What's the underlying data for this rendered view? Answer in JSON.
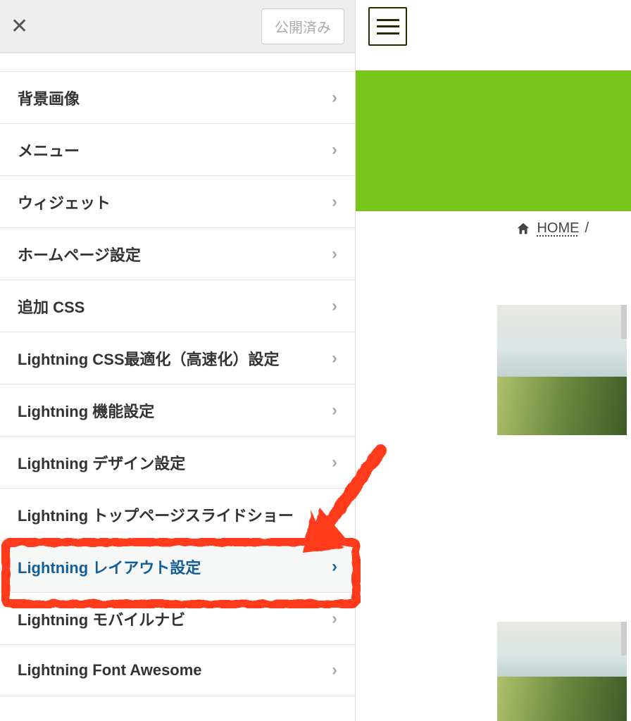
{
  "topbar": {
    "publish_label": "公開済み"
  },
  "sidebar": {
    "items": [
      {
        "label": "背景画像",
        "active": false
      },
      {
        "label": "メニュー",
        "active": false
      },
      {
        "label": "ウィジェット",
        "active": false
      },
      {
        "label": "ホームページ設定",
        "active": false
      },
      {
        "label": "追加 CSS",
        "active": false
      },
      {
        "label": "Lightning CSS最適化（高速化）設定",
        "active": false
      },
      {
        "label": "Lightning 機能設定",
        "active": false
      },
      {
        "label": "Lightning デザイン設定",
        "active": false
      },
      {
        "label": "Lightning トップページスライドショー",
        "active": false
      },
      {
        "label": "Lightning レイアウト設定",
        "active": true
      },
      {
        "label": "Lightning モバイルナビ",
        "active": false
      },
      {
        "label": "Lightning Font Awesome",
        "active": false
      }
    ]
  },
  "preview": {
    "breadcrumb": {
      "home": "HOME",
      "sep": "/"
    }
  },
  "colors": {
    "accent": "#135e96",
    "header_bg": "#7ac51c",
    "annotation": "#ff3b1f"
  }
}
